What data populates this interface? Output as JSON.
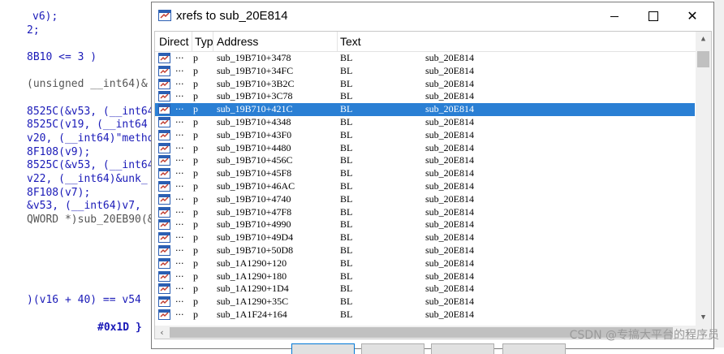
{
  "background_code": {
    "lines": [
      "v6);",
      "2;",
      "",
      "8B10 <= 3 )",
      "",
      "(unsigned __int64)&",
      "",
      "8525C(&v53, (__int64",
      "8525C(v19, (__int64",
      "v20, (__int64)\"metho",
      "8F108(v9);",
      "8525C(&v53, (__int64",
      "v22, (__int64)&unk_",
      "8F108(v7);",
      "&v53, (__int64)v7, ",
      "QWORD *)sub_20EB90(&"
    ],
    "line_a": ")(v16 + 40) == v54",
    "line_b": "#0x1D }"
  },
  "dialog": {
    "title": "xrefs to sub_20E814",
    "title_icon": "xrefs-window-icon",
    "min_icon": "minimize-icon",
    "max_icon": "maximize-icon",
    "close_glyph": "✕"
  },
  "columns": {
    "direction": "Direct",
    "type": "Typ",
    "address": "Address",
    "text": "Text"
  },
  "rows": [
    {
      "dots": "···",
      "type": "p",
      "address": "sub_19B710+3478",
      "text": "BL",
      "target": "sub_20E814"
    },
    {
      "dots": "···",
      "type": "p",
      "address": "sub_19B710+34FC",
      "text": "BL",
      "target": "sub_20E814"
    },
    {
      "dots": "···",
      "type": "p",
      "address": "sub_19B710+3B2C",
      "text": "BL",
      "target": "sub_20E814"
    },
    {
      "dots": "···",
      "type": "p",
      "address": "sub_19B710+3C78",
      "text": "BL",
      "target": "sub_20E814"
    },
    {
      "dots": "···",
      "type": "p",
      "address": "sub_19B710+421C",
      "text": "BL",
      "target": "sub_20E814",
      "selected": true
    },
    {
      "dots": "···",
      "type": "p",
      "address": "sub_19B710+4348",
      "text": "BL",
      "target": "sub_20E814"
    },
    {
      "dots": "···",
      "type": "p",
      "address": "sub_19B710+43F0",
      "text": "BL",
      "target": "sub_20E814"
    },
    {
      "dots": "···",
      "type": "p",
      "address": "sub_19B710+4480",
      "text": "BL",
      "target": "sub_20E814"
    },
    {
      "dots": "···",
      "type": "p",
      "address": "sub_19B710+456C",
      "text": "BL",
      "target": "sub_20E814"
    },
    {
      "dots": "···",
      "type": "p",
      "address": "sub_19B710+45F8",
      "text": "BL",
      "target": "sub_20E814"
    },
    {
      "dots": "···",
      "type": "p",
      "address": "sub_19B710+46AC",
      "text": "BL",
      "target": "sub_20E814"
    },
    {
      "dots": "···",
      "type": "p",
      "address": "sub_19B710+4740",
      "text": "BL",
      "target": "sub_20E814"
    },
    {
      "dots": "···",
      "type": "p",
      "address": "sub_19B710+47F8",
      "text": "BL",
      "target": "sub_20E814"
    },
    {
      "dots": "···",
      "type": "p",
      "address": "sub_19B710+4990",
      "text": "BL",
      "target": "sub_20E814"
    },
    {
      "dots": "···",
      "type": "p",
      "address": "sub_19B710+49D4",
      "text": "BL",
      "target": "sub_20E814"
    },
    {
      "dots": "···",
      "type": "p",
      "address": "sub_19B710+50D8",
      "text": "BL",
      "target": "sub_20E814"
    },
    {
      "dots": "···",
      "type": "p",
      "address": "sub_1A1290+120",
      "text": "BL",
      "target": "sub_20E814"
    },
    {
      "dots": "···",
      "type": "p",
      "address": "sub_1A1290+180",
      "text": "BL",
      "target": "sub_20E814"
    },
    {
      "dots": "···",
      "type": "p",
      "address": "sub_1A1290+1D4",
      "text": "BL",
      "target": "sub_20E814"
    },
    {
      "dots": "···",
      "type": "p",
      "address": "sub_1A1290+35C",
      "text": "BL",
      "target": "sub_20E814"
    },
    {
      "dots": "···",
      "type": "p",
      "address": "sub_1A1F24+164",
      "text": "BL",
      "target": "sub_20E814"
    }
  ],
  "watermark": "CSDN @专搞大平台的程序员",
  "colors": {
    "selection": "#2a7fd4",
    "code_blue": "#1a1ab8",
    "xref_icon_blue": "#2b5fb3"
  }
}
